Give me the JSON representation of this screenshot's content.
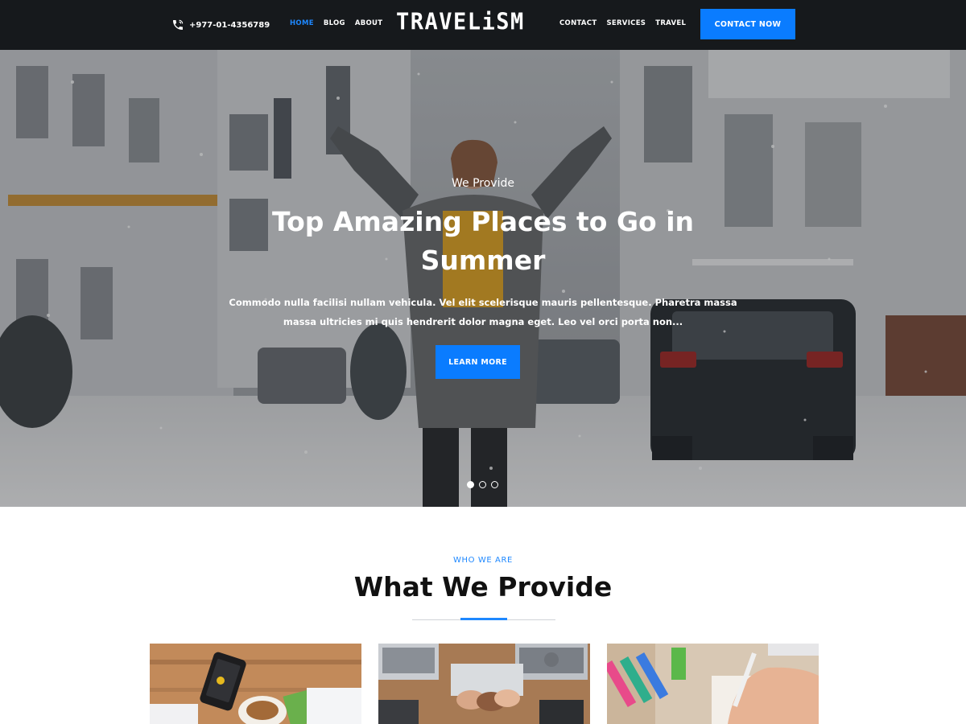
{
  "header": {
    "phone": "+977-01-4356789",
    "nav_left": [
      {
        "label": "HOME",
        "active": true
      },
      {
        "label": "BLOG",
        "active": false
      },
      {
        "label": "ABOUT",
        "active": false
      }
    ],
    "logo": "TRAVELiSM",
    "nav_right": [
      {
        "label": "CONTACT",
        "active": false
      },
      {
        "label": "SERVICES",
        "active": false
      },
      {
        "label": "TRAVEL",
        "active": false
      }
    ],
    "cta_label": "CONTACT NOW"
  },
  "hero": {
    "eyebrow": "We Provide",
    "title": "Top Amazing Places to Go in Summer",
    "description": "Commodo nulla facilisi nullam vehicula. Vel elit scelerisque mauris pellentesque. Pharetra massa massa ultricies mi quis hendrerit dolor magna eget. Leo vel orci porta non...",
    "button_label": "LEARN MORE",
    "slides_total": 3,
    "active_slide": 1
  },
  "section": {
    "eyebrow": "WHO WE ARE",
    "title": "What We Provide"
  },
  "icons": {
    "phone": "phone-icon"
  },
  "colors": {
    "accent": "#1e88ff",
    "button": "#0a7cff",
    "header_bg": "#16191c"
  }
}
